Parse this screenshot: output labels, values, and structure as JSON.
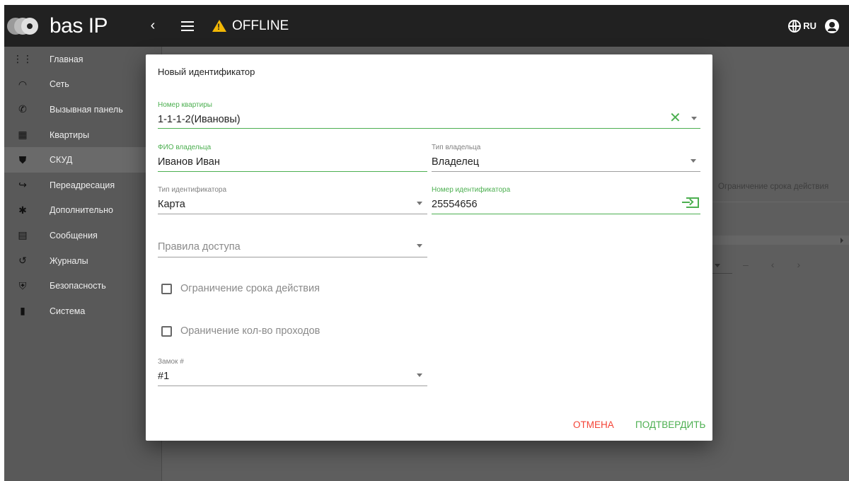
{
  "header": {
    "logo_text": "bas IP",
    "collapse_icon": "chevron-left-icon",
    "menu_icon": "hamburger-icon",
    "status_text": "OFFLINE",
    "status_icon": "warning-icon",
    "language": "RU",
    "colors": {
      "bar": "#212121",
      "warning": "#f2b705"
    }
  },
  "sidebar": {
    "items": [
      {
        "label": "Главная",
        "icon": "grid-icon"
      },
      {
        "label": "Сеть",
        "icon": "wifi-icon"
      },
      {
        "label": "Вызывная панель",
        "icon": "phone-icon"
      },
      {
        "label": "Квартиры",
        "icon": "building-icon"
      },
      {
        "label": "СКУД",
        "icon": "shield-check-icon",
        "active": true
      },
      {
        "label": "Переадресация",
        "icon": "phone-forward-icon"
      },
      {
        "label": "Дополнительно",
        "icon": "gear-icon"
      },
      {
        "label": "Сообщения",
        "icon": "message-icon"
      },
      {
        "label": "Журналы",
        "icon": "history-icon"
      },
      {
        "label": "Безопасность",
        "icon": "security-icon"
      },
      {
        "label": "Система",
        "icon": "device-icon"
      }
    ]
  },
  "background": {
    "column_header": "Ограничение срока действия",
    "pager_dash": "–",
    "pager_prev": "‹",
    "pager_next": "›"
  },
  "dialog": {
    "title": "Новый идентификатор",
    "apartment": {
      "label": "Номер квартиры",
      "value": "1-1-1-2(Ивановы)",
      "clear": "✕"
    },
    "owner_name": {
      "label": "ФИО владельца",
      "value": "Иванов Иван"
    },
    "owner_type": {
      "label": "Тип владельца",
      "value": "Владелец"
    },
    "id_type": {
      "label": "Тип идентификатора",
      "value": "Карта"
    },
    "id_number": {
      "label": "Номер идентификатора",
      "value": "25554656"
    },
    "access_rules": {
      "placeholder": "Правила доступа"
    },
    "validity_limit": {
      "label": "Ограничение срока действия",
      "checked": false
    },
    "pass_limit": {
      "label": "Ораничение кол-во проходов",
      "checked": false
    },
    "lock": {
      "label": "Замок #",
      "value": "#1"
    },
    "cancel_label": "ОТМЕНА",
    "confirm_label": "ПОДТВЕРДИТЬ",
    "colors": {
      "accent": "#4caf50",
      "cancel": "#f44336"
    }
  }
}
